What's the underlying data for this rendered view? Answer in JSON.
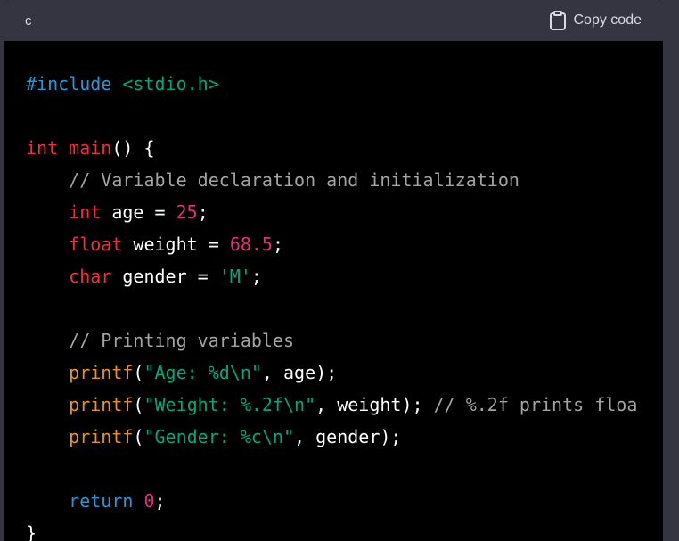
{
  "header": {
    "language": "c",
    "copy_label": "Copy code"
  },
  "code": {
    "lines": [
      [
        {
          "t": "#include ",
          "c": "pre"
        },
        {
          "t": "<stdio.h>",
          "c": "str"
        }
      ],
      [],
      [
        {
          "t": "int",
          "c": "kw"
        },
        {
          "t": " ",
          "c": "plain"
        },
        {
          "t": "main",
          "c": "fn"
        },
        {
          "t": "() {",
          "c": "plain"
        }
      ],
      [
        {
          "t": "    ",
          "c": "plain"
        },
        {
          "t": "// Variable declaration and initialization",
          "c": "com"
        }
      ],
      [
        {
          "t": "    ",
          "c": "plain"
        },
        {
          "t": "int",
          "c": "kw"
        },
        {
          "t": " age = ",
          "c": "plain"
        },
        {
          "t": "25",
          "c": "num"
        },
        {
          "t": ";",
          "c": "plain"
        }
      ],
      [
        {
          "t": "    ",
          "c": "plain"
        },
        {
          "t": "float",
          "c": "kw"
        },
        {
          "t": " weight = ",
          "c": "plain"
        },
        {
          "t": "68.5",
          "c": "num"
        },
        {
          "t": ";",
          "c": "plain"
        }
      ],
      [
        {
          "t": "    ",
          "c": "plain"
        },
        {
          "t": "char",
          "c": "kw"
        },
        {
          "t": " gender = ",
          "c": "plain"
        },
        {
          "t": "'M'",
          "c": "str"
        },
        {
          "t": ";",
          "c": "plain"
        }
      ],
      [],
      [
        {
          "t": "    ",
          "c": "plain"
        },
        {
          "t": "// Printing variables",
          "c": "com"
        }
      ],
      [
        {
          "t": "    ",
          "c": "plain"
        },
        {
          "t": "printf",
          "c": "call"
        },
        {
          "t": "(",
          "c": "plain"
        },
        {
          "t": "\"Age: %d\\n\"",
          "c": "str"
        },
        {
          "t": ", age);",
          "c": "plain"
        }
      ],
      [
        {
          "t": "    ",
          "c": "plain"
        },
        {
          "t": "printf",
          "c": "call"
        },
        {
          "t": "(",
          "c": "plain"
        },
        {
          "t": "\"Weight: %.2f\\n\"",
          "c": "str"
        },
        {
          "t": ", weight); ",
          "c": "plain"
        },
        {
          "t": "// %.2f prints floa",
          "c": "com"
        }
      ],
      [
        {
          "t": "    ",
          "c": "plain"
        },
        {
          "t": "printf",
          "c": "call"
        },
        {
          "t": "(",
          "c": "plain"
        },
        {
          "t": "\"Gender: %c\\n\"",
          "c": "str"
        },
        {
          "t": ", gender);",
          "c": "plain"
        }
      ],
      [],
      [
        {
          "t": "    ",
          "c": "plain"
        },
        {
          "t": "return",
          "c": "ret"
        },
        {
          "t": " ",
          "c": "plain"
        },
        {
          "t": "0",
          "c": "num"
        },
        {
          "t": ";",
          "c": "plain"
        }
      ],
      [
        {
          "t": "}",
          "c": "plain"
        }
      ]
    ]
  },
  "colors": {
    "background": "#000000",
    "header_bg": "#343541",
    "preprocessor": "#2e95d3",
    "string": "#00a67d",
    "keyword": "#f22c3d",
    "number": "#df3079",
    "comment": "#a3a3a3",
    "function_call": "#e9950c"
  },
  "icons": {
    "copy": "clipboard-icon"
  }
}
